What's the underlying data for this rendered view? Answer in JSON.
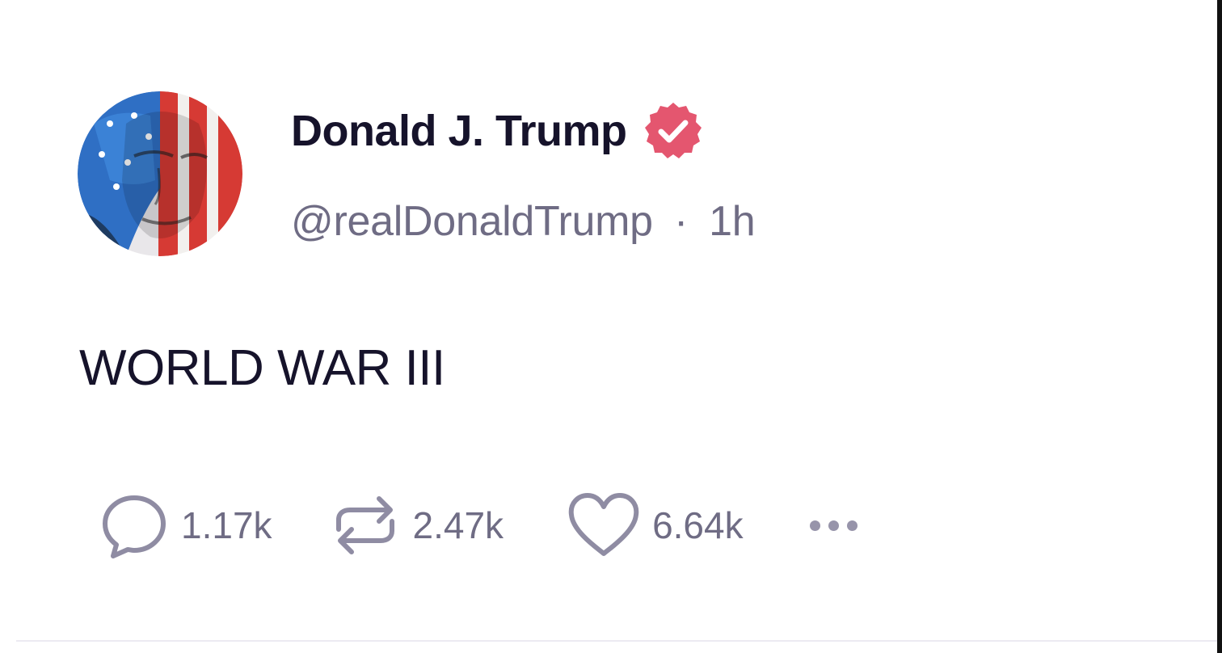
{
  "post": {
    "author": {
      "display_name": "Donald J. Trump",
      "handle": "@realDonaldTrump",
      "verified": true,
      "avatar_icon": "flag-face-avatar"
    },
    "separator": "·",
    "time_ago": "1h",
    "text": "WORLD WAR III",
    "actions": {
      "replies": {
        "icon": "reply-icon",
        "count": "1.17k"
      },
      "reposts": {
        "icon": "repost-icon",
        "count": "2.47k"
      },
      "likes": {
        "icon": "heart-icon",
        "count": "6.64k"
      },
      "more": {
        "icon": "more-icon"
      }
    }
  },
  "colors": {
    "name_text": "#16132b",
    "meta_text": "#6f6c84",
    "verified_badge": "#e4566f",
    "icon_stroke": "#8f8ca3"
  }
}
